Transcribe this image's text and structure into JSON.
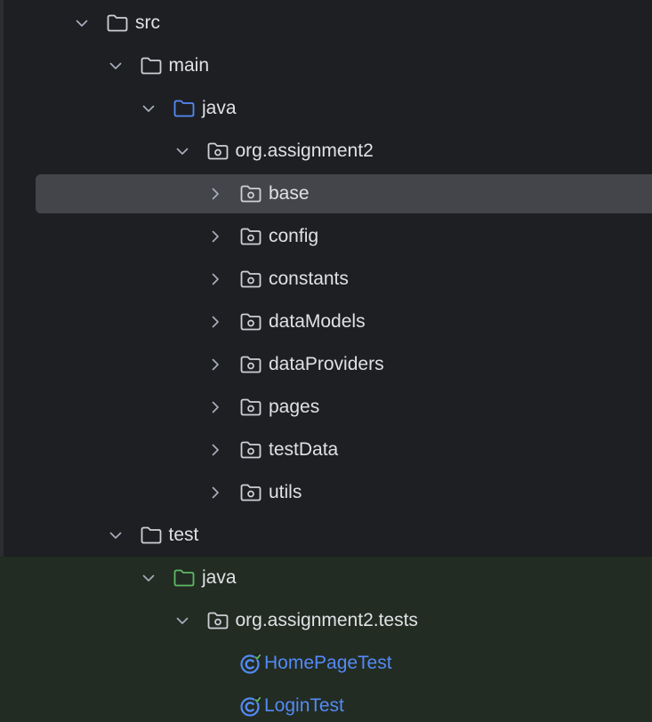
{
  "colors": {
    "background": "#1e1f22",
    "selection": "#43454a",
    "test_sources_background": "#222c22",
    "text": "#dfe1e5",
    "class_text": "#548af7",
    "folder_icon": "#ced0d6",
    "source_root_icon": "#548af7",
    "test_root_icon": "#5fb865"
  },
  "tree": [
    {
      "label": "src",
      "depth": 0,
      "expanded": true,
      "icon": "folder-icon",
      "selected": false,
      "test_area": false
    },
    {
      "label": "main",
      "depth": 1,
      "expanded": true,
      "icon": "folder-icon",
      "selected": false,
      "test_area": false
    },
    {
      "label": "java",
      "depth": 2,
      "expanded": true,
      "icon": "source-root-folder-icon",
      "selected": false,
      "test_area": false
    },
    {
      "label": "org.assignment2",
      "depth": 3,
      "expanded": true,
      "icon": "package-icon",
      "selected": false,
      "test_area": false
    },
    {
      "label": "base",
      "depth": 4,
      "expanded": false,
      "icon": "package-icon",
      "selected": true,
      "test_area": false
    },
    {
      "label": "config",
      "depth": 4,
      "expanded": false,
      "icon": "package-icon",
      "selected": false,
      "test_area": false
    },
    {
      "label": "constants",
      "depth": 4,
      "expanded": false,
      "icon": "package-icon",
      "selected": false,
      "test_area": false
    },
    {
      "label": "dataModels",
      "depth": 4,
      "expanded": false,
      "icon": "package-icon",
      "selected": false,
      "test_area": false
    },
    {
      "label": "dataProviders",
      "depth": 4,
      "expanded": false,
      "icon": "package-icon",
      "selected": false,
      "test_area": false
    },
    {
      "label": "pages",
      "depth": 4,
      "expanded": false,
      "icon": "package-icon",
      "selected": false,
      "test_area": false
    },
    {
      "label": "testData",
      "depth": 4,
      "expanded": false,
      "icon": "package-icon",
      "selected": false,
      "test_area": false
    },
    {
      "label": "utils",
      "depth": 4,
      "expanded": false,
      "icon": "package-icon",
      "selected": false,
      "test_area": false
    },
    {
      "label": "test",
      "depth": 1,
      "expanded": true,
      "icon": "folder-icon",
      "selected": false,
      "test_area": false
    },
    {
      "label": "java",
      "depth": 2,
      "expanded": true,
      "icon": "test-root-folder-icon",
      "selected": false,
      "test_area": true
    },
    {
      "label": "org.assignment2.tests",
      "depth": 3,
      "expanded": true,
      "icon": "package-icon",
      "selected": false,
      "test_area": true
    },
    {
      "label": "HomePageTest",
      "depth": 4,
      "leaf": true,
      "icon": "test-class-icon",
      "selected": false,
      "test_area": true
    },
    {
      "label": "LoginTest",
      "depth": 4,
      "leaf": true,
      "icon": "test-class-icon",
      "selected": false,
      "test_area": true
    }
  ]
}
